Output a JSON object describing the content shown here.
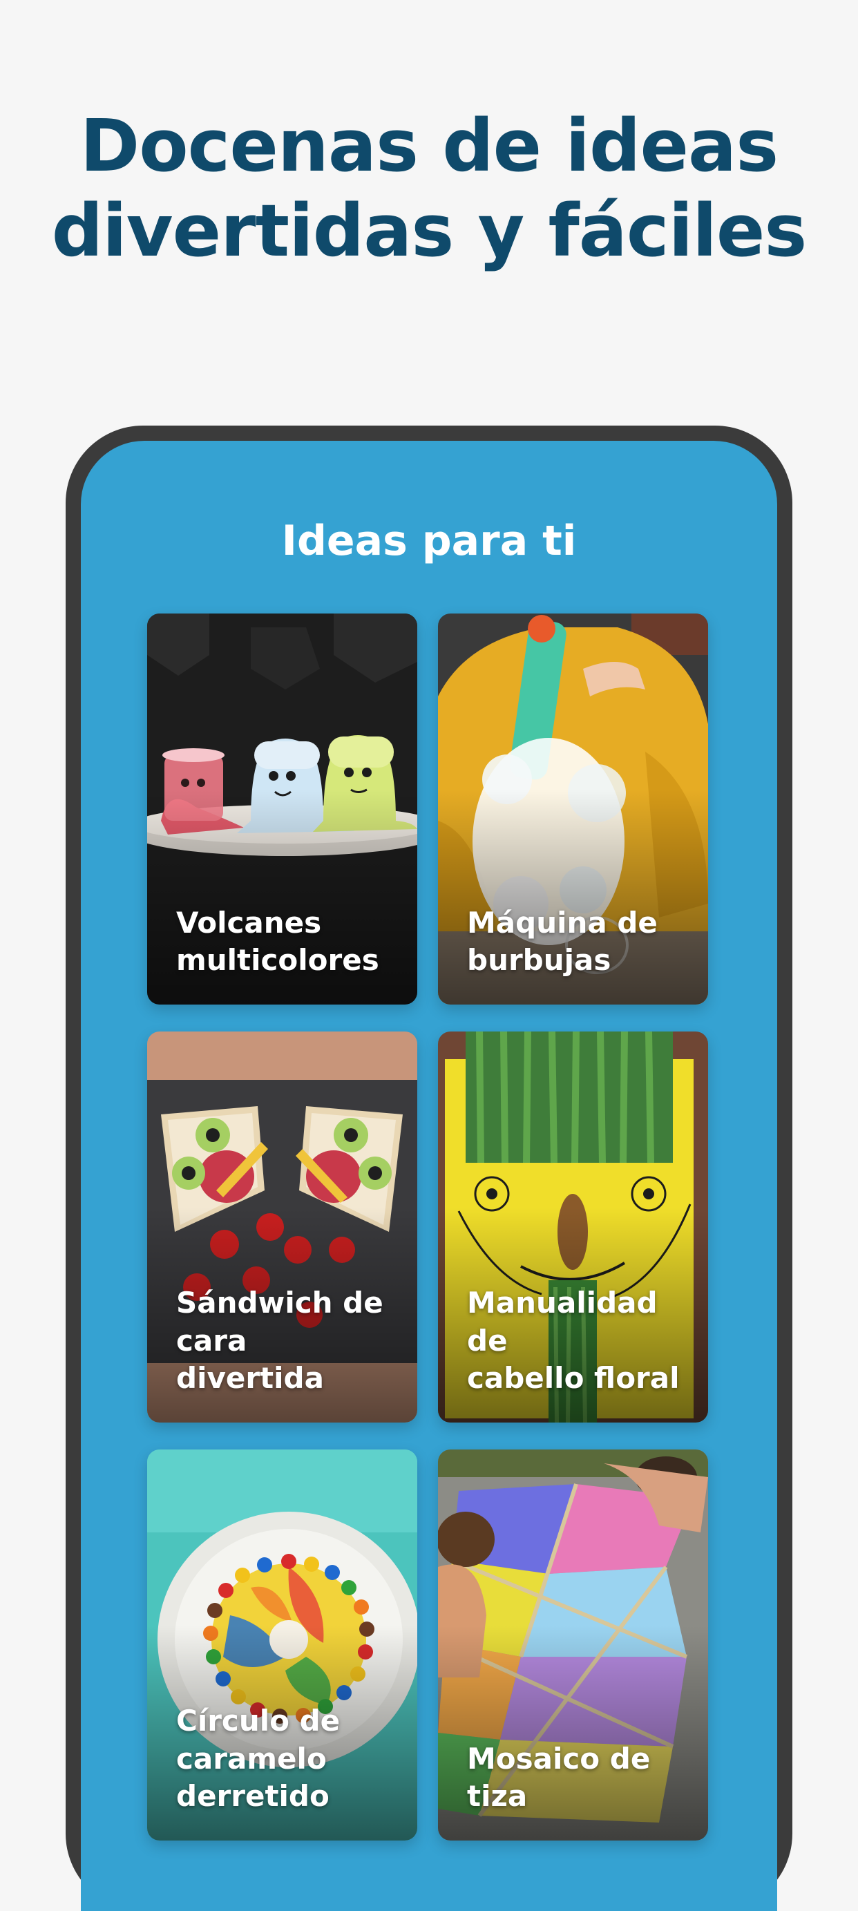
{
  "headline": {
    "line1": "Docenas de ideas",
    "line2": "divertidas y fáciles"
  },
  "screen": {
    "title": "Ideas para ti",
    "cards": [
      {
        "line1": "Volcanes",
        "line2": "multicolores",
        "line3": ""
      },
      {
        "line1": "Máquina de",
        "line2": "burbujas",
        "line3": ""
      },
      {
        "line1": "Sándwich de",
        "line2": "cara divertida",
        "line3": ""
      },
      {
        "line1": "Manualidad de",
        "line2": "cabello floral",
        "line3": ""
      },
      {
        "line1": "Círculo de",
        "line2": "caramelo",
        "line3": "derretido"
      },
      {
        "line1": "Mosaico de",
        "line2": "tiza",
        "line3": ""
      }
    ]
  },
  "colors": {
    "background": "#f6f6f6",
    "headline": "#0f4a6b",
    "phone_frame": "#3b3b3b",
    "screen": "#35a2d2"
  },
  "icons": [
    "volcano-cups-photo",
    "bubble-machine-photo",
    "funny-face-sandwich-photo",
    "floral-hair-craft-photo",
    "melted-candy-circle-photo",
    "chalk-mosaic-photo"
  ]
}
